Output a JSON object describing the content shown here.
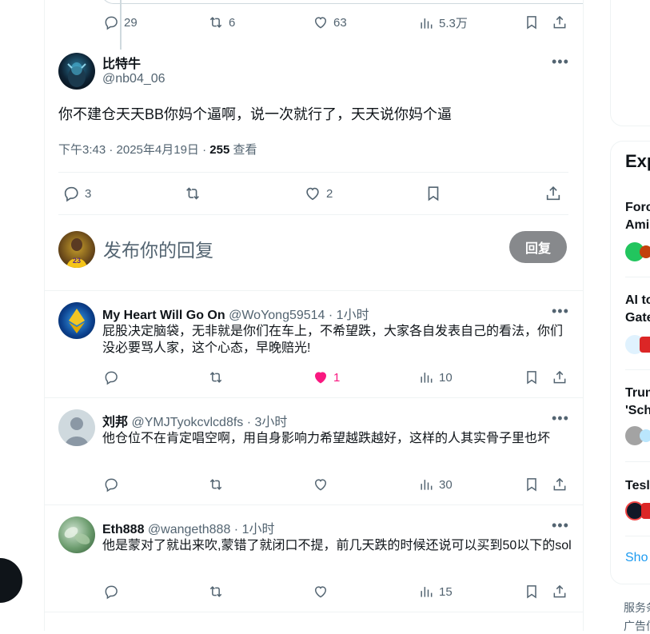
{
  "prev_tweet_actions": {
    "replies": "29",
    "retweets": "6",
    "likes": "63",
    "views": "5.3万"
  },
  "main_tweet": {
    "name": "比特牛",
    "handle": "@nb04_06",
    "text": "你不建仓天天BB你妈个逼啊，说一次就行了，天天说你妈个逼",
    "time": "下午3:43 · 2025年4月19日 · ",
    "views_count": "255",
    "views_label": " 查看",
    "replies": "3",
    "likes": "2"
  },
  "composer": {
    "placeholder": "发布你的回复",
    "button": "回复"
  },
  "replies": [
    {
      "name": "My Heart Will Go On",
      "handle": "@WoYong59514",
      "time": " · 1小时",
      "text": "屁股决定脑袋，无非就是你们在车上，不希望跌，大家各自发表自己的看法，你们没必要骂人家，这个心态，早晚赔光!",
      "replies": "",
      "retweets": "",
      "likes": "1",
      "views": "10"
    },
    {
      "name": "刘邦",
      "handle": "@YMJTyokcvlcd8fs",
      "time": " · 3小时",
      "text": "他仓位不在肯定唱空啊，用自身影响力希望越跌越好，这样的人其实骨子里也坏",
      "replies": "",
      "retweets": "",
      "likes": "",
      "views": "30"
    },
    {
      "name": "Eth888",
      "handle": "@wangeth888",
      "time": " · 1小时",
      "text": "他是蒙对了就出来吹,蒙错了就闭口不提，前几天跌的时候还说可以买到50以下的sol",
      "replies": "",
      "retweets": "",
      "likes": "",
      "views": "15"
    }
  ],
  "right_sidebar": {
    "title": "Exp",
    "items": [
      "Forc",
      "Amir",
      "AI to",
      "Gate",
      "Trum",
      "'Sch",
      "Tesl"
    ],
    "show_more": "Sho",
    "footer_1": "服务条",
    "footer_2": "广告信"
  },
  "colors": {
    "accent": "#1d9bf0",
    "like": "#f91880",
    "muted": "#536471",
    "reply_button_bg": "#87898c"
  }
}
